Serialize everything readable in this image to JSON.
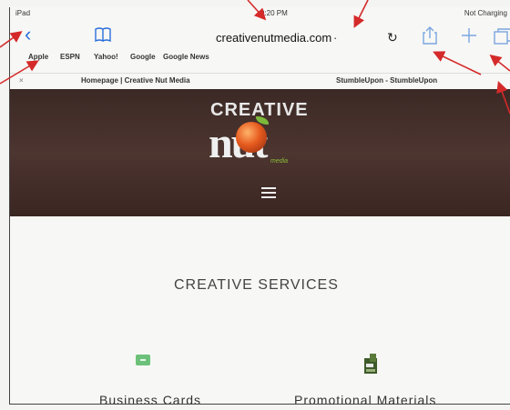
{
  "status": {
    "carrier": "iPad",
    "time": "9:20 PM",
    "battery": "Not Charging"
  },
  "toolbar": {
    "url": "creativenutmedia.com"
  },
  "favorites": [
    "Apple",
    "ESPN",
    "Yahoo!",
    "Google",
    "Google News"
  ],
  "tabs": {
    "left": "Homepage | Creative Nut Media",
    "right": "StumbleUpon - StumbleUpon"
  },
  "logo": {
    "line1": "CREATIVE",
    "line2": "nut",
    "tag": "media"
  },
  "content": {
    "section_title": "CREATIVE SERVICES",
    "services": [
      "Business Cards",
      "Promotional Materials"
    ]
  },
  "colors": {
    "annotation_arrow": "#d42a2a",
    "hero_bg": "#3f2c28",
    "link_blue": "#2a6fdb"
  },
  "icons": [
    "back-icon",
    "bookmarks-icon",
    "reload-icon",
    "share-icon",
    "new-tab-icon",
    "tabs-icon",
    "menu-icon"
  ]
}
